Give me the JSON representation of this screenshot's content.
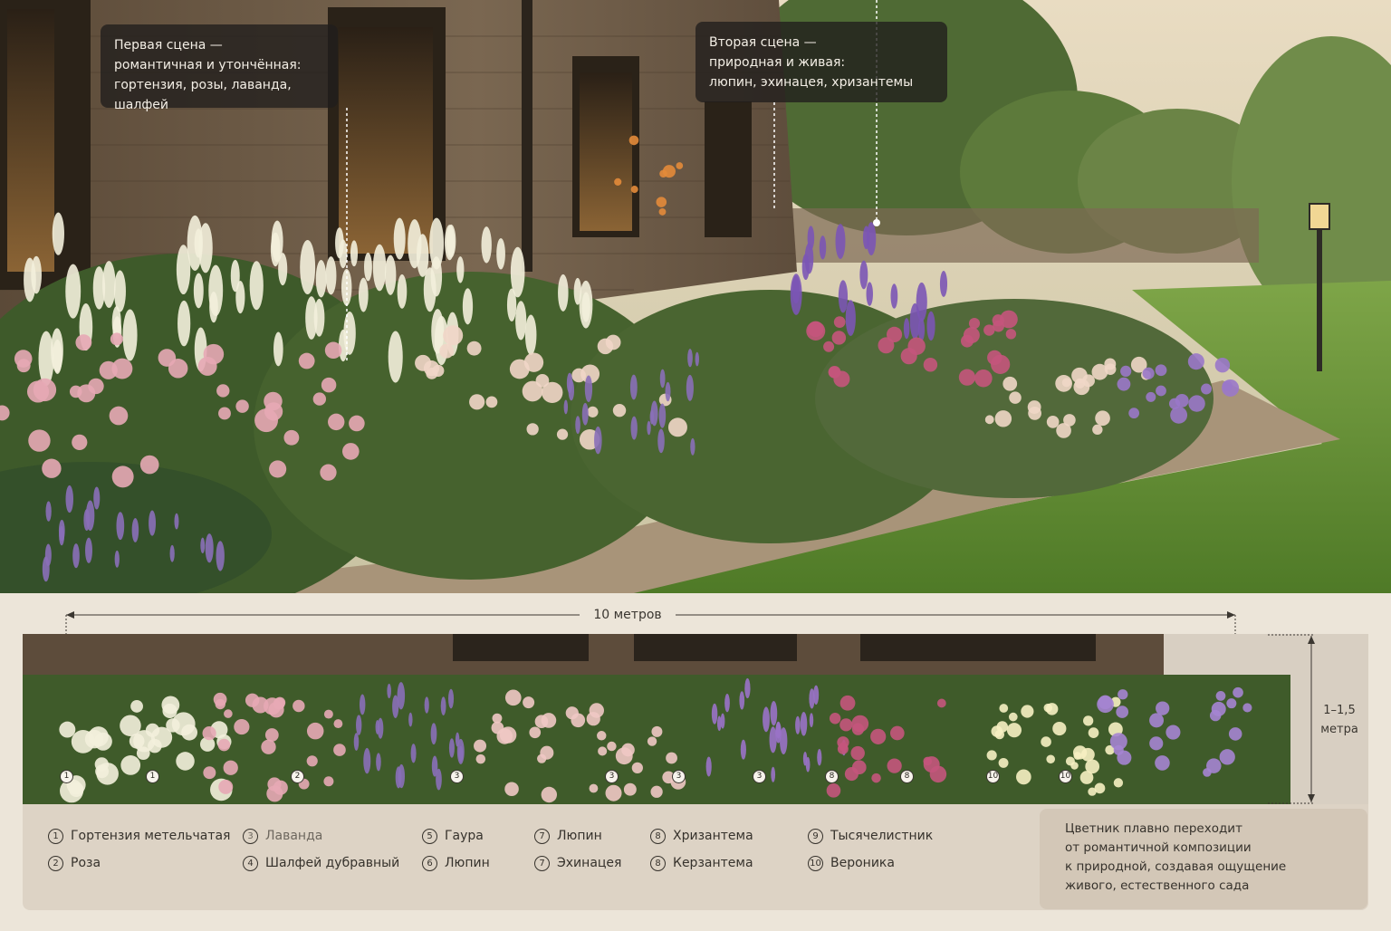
{
  "callouts": {
    "first": {
      "line1": "Первая сцена —",
      "line2": "романтичная и утончённая:",
      "line3": "гортензия, розы, лаванда, шалфей"
    },
    "second": {
      "line1": "Вторая сцена —",
      "line2": "природная и живая:",
      "line3": "люпин, эхинацея, хризантемы"
    }
  },
  "plan": {
    "length_label": "10 метров",
    "height_label_line1": "1–1,5",
    "height_label_line2": "метра",
    "markers": [
      "1",
      "1",
      "2",
      "3",
      "3",
      "3",
      "3",
      "8",
      "8",
      "10",
      "10"
    ]
  },
  "legend": [
    {
      "num": "1",
      "label": "Гортензия метельчатая"
    },
    {
      "num": "2",
      "label": "Роза"
    },
    {
      "num": "3",
      "label": "Лаванда"
    },
    {
      "num": "4",
      "label": "Шалфей дубравный"
    },
    {
      "num": "5",
      "label": "Гаура"
    },
    {
      "num": "6",
      "label": "Люпин"
    },
    {
      "num": "7",
      "label": "Люпин"
    },
    {
      "num": "7",
      "label": "Эхинацея"
    },
    {
      "num": "8",
      "label": "Хризантема"
    },
    {
      "num": "8",
      "label": "Керзантема"
    },
    {
      "num": "9",
      "label": "Тысячелистник"
    },
    {
      "num": "10",
      "label": "Вероника"
    }
  ],
  "summary": {
    "line1": "Цветник плавно переходит",
    "line2": "от романтичной композиции",
    "line3": "к природной, создавая ощущение",
    "line4": "живого, естественного сада"
  },
  "colors": {
    "wood_wall": "#6b5a47",
    "lawn": "#6f9a3c",
    "path": "#9c8b74",
    "hydrangea": "#f3efdc",
    "rose": "#e7a9b5",
    "lavender": "#8a6fb8",
    "echinacea": "#c4557c",
    "panel": "#ddd3c5"
  }
}
